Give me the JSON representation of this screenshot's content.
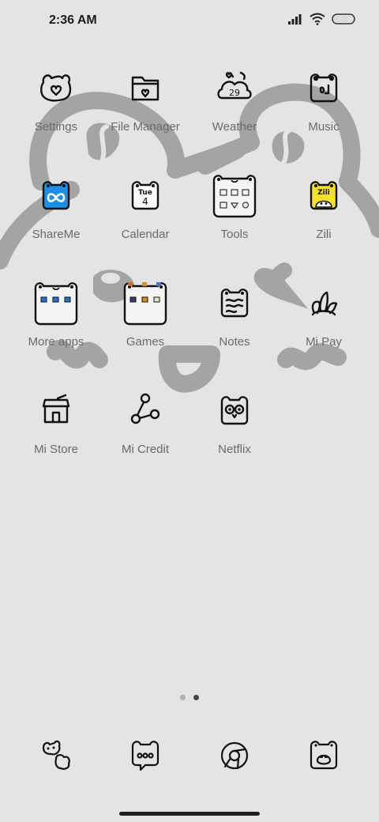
{
  "status_bar": {
    "time": "2:36 AM",
    "signal_icon": "signal-bars-icon",
    "wifi_icon": "wifi-icon",
    "battery_icon": "battery-icon"
  },
  "apps": [
    {
      "label": "Settings",
      "icon": "settings-icon"
    },
    {
      "label": "File Manager",
      "icon": "folder-icon"
    },
    {
      "label": "Weather",
      "icon": "weather-icon",
      "icon_text": "29"
    },
    {
      "label": "Music",
      "icon": "music-icon"
    },
    {
      "label": "ShareMe",
      "icon": "shareme-icon"
    },
    {
      "label": "Calendar",
      "icon": "calendar-icon",
      "day": "Tue",
      "date": "4"
    },
    {
      "label": "Tools",
      "icon": "tools-folder-icon"
    },
    {
      "label": "Zili",
      "icon": "zili-icon",
      "icon_text": "Zili"
    },
    {
      "label": "More apps",
      "icon": "more-apps-folder-icon"
    },
    {
      "label": "Games",
      "icon": "games-folder-icon"
    },
    {
      "label": "Notes",
      "icon": "notes-icon"
    },
    {
      "label": "Mi Pay",
      "icon": "mi-pay-icon"
    },
    {
      "label": "Mi Store",
      "icon": "store-icon"
    },
    {
      "label": "Mi Credit",
      "icon": "credit-share-icon"
    },
    {
      "label": "Netflix",
      "icon": "netflix-owl-icon"
    }
  ],
  "pager": {
    "pages": 2,
    "active_page": 2
  },
  "dock": [
    {
      "icon": "phone-icon"
    },
    {
      "icon": "messages-icon"
    },
    {
      "icon": "browser-icon"
    },
    {
      "icon": "camera-icon"
    }
  ],
  "colors": {
    "background": "#e4e4e4",
    "wallpaper_stroke": "#a4a4a4",
    "label_text": "#6a6a6a",
    "shareme_blue": "#1e8fe6",
    "zili_yellow": "#f5e12a"
  }
}
